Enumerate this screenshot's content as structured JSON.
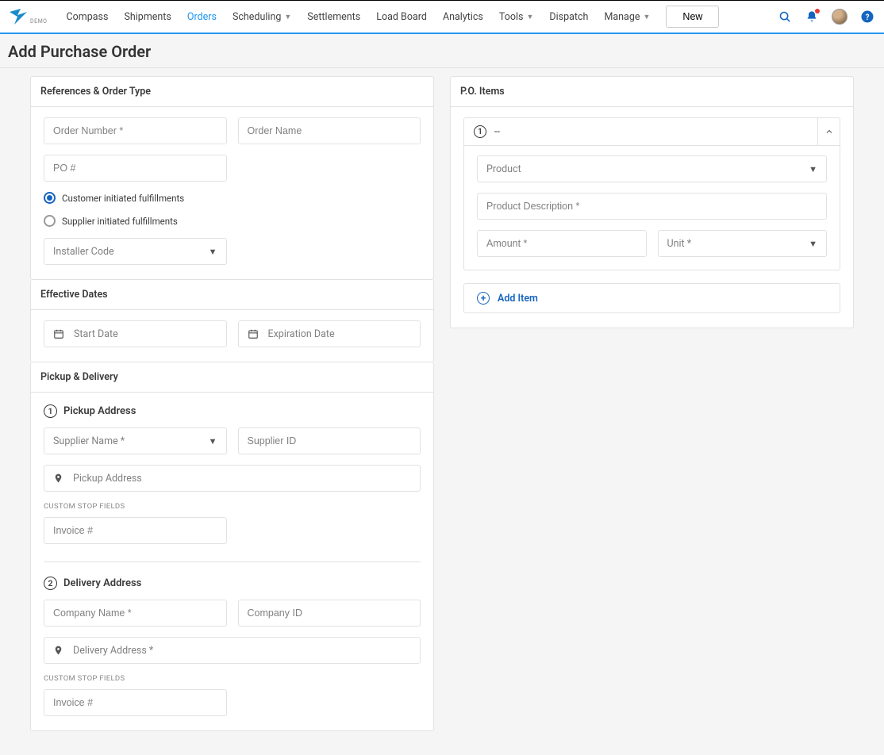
{
  "logo_text": "DEMO",
  "nav": {
    "compass": "Compass",
    "shipments": "Shipments",
    "orders": "Orders",
    "scheduling": "Scheduling",
    "settlements": "Settlements",
    "loadboard": "Load Board",
    "analytics": "Analytics",
    "tools": "Tools",
    "dispatch": "Dispatch",
    "manage": "Manage",
    "new": "New"
  },
  "page_title": "Add Purchase Order",
  "refs": {
    "header": "References & Order Type",
    "order_number_ph": "Order Number *",
    "order_name_ph": "Order Name",
    "po_ph": "PO #",
    "radio_customer": "Customer initiated fulfillments",
    "radio_supplier": "Supplier initiated fulfillments",
    "installer_ph": "Installer Code"
  },
  "dates": {
    "header": "Effective Dates",
    "start_ph": "Start Date",
    "end_ph": "Expiration Date"
  },
  "pd": {
    "header": "Pickup & Delivery",
    "pickup_h": "Pickup Address",
    "supplier_name_ph": "Supplier Name *",
    "supplier_id_ph": "Supplier ID",
    "pickup_addr_ph": "Pickup Address",
    "custom_label": "Custom Stop Fields",
    "invoice_ph": "Invoice #",
    "delivery_h": "Delivery Address",
    "company_name_ph": "Company Name *",
    "company_id_ph": "Company ID",
    "delivery_addr_ph": "Delivery Address *"
  },
  "po": {
    "header": "P.O. Items",
    "item_title": "--",
    "product_ph": "Product",
    "desc_ph": "Product Description *",
    "amount_ph": "Amount *",
    "unit_ph": "Unit *",
    "add_item": "Add Item"
  }
}
